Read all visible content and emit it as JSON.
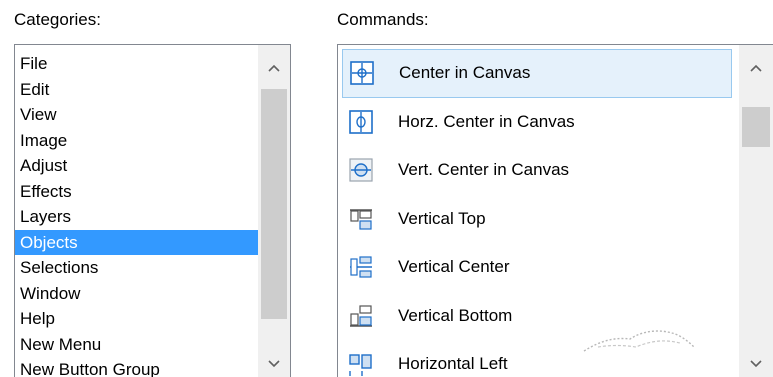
{
  "categories": {
    "label": "Categories:",
    "items": [
      "File",
      "Edit",
      "View",
      "Image",
      "Adjust",
      "Effects",
      "Layers",
      "Objects",
      "Selections",
      "Window",
      "Help",
      "New Menu",
      "New Button Group"
    ],
    "selected_index": 7
  },
  "commands": {
    "label": "Commands:",
    "items": [
      {
        "label": "Center in Canvas",
        "icon": "center-in-canvas-icon"
      },
      {
        "label": "Horz. Center in Canvas",
        "icon": "horz-center-icon"
      },
      {
        "label": "Vert. Center in Canvas",
        "icon": "vert-center-icon"
      },
      {
        "label": "Vertical Top",
        "icon": "align-vertical-top-icon"
      },
      {
        "label": "Vertical Center",
        "icon": "align-vertical-center-icon"
      },
      {
        "label": "Vertical Bottom",
        "icon": "align-vertical-bottom-icon"
      },
      {
        "label": "Horizontal Left",
        "icon": "align-horizontal-left-icon"
      }
    ],
    "selected_index": 0
  },
  "colors": {
    "selection_blue": "#3399ff",
    "command_highlight": "#e5f1fb",
    "icon_blue": "#1e6fc9"
  }
}
